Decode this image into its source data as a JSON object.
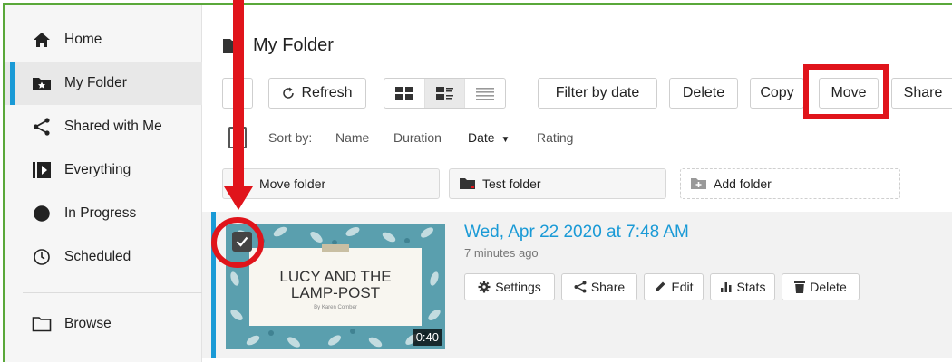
{
  "sidebar": {
    "items": [
      {
        "label": "Home",
        "icon": "home-icon"
      },
      {
        "label": "My Folder",
        "icon": "folder-star-icon",
        "active": true
      },
      {
        "label": "Shared with Me",
        "icon": "share-icon"
      },
      {
        "label": "Everything",
        "icon": "play-library-icon"
      },
      {
        "label": "In Progress",
        "icon": "half-circle-icon"
      },
      {
        "label": "Scheduled",
        "icon": "clock-icon"
      },
      {
        "label": "Browse",
        "icon": "folder-outline-icon"
      }
    ]
  },
  "header": {
    "title": "My Folder"
  },
  "toolbar": {
    "refresh": "Refresh",
    "filter": "Filter by date",
    "delete": "Delete",
    "copy": "Copy",
    "move": "Move",
    "share": "Share"
  },
  "sort": {
    "label": "Sort by:",
    "options": [
      "Name",
      "Duration",
      "Date",
      "Rating"
    ],
    "active": "Date"
  },
  "folders": [
    {
      "label": "Move folder"
    },
    {
      "label": "Test folder"
    },
    {
      "label": "Add folder"
    }
  ],
  "item": {
    "title": "Wed, Apr 22 2020 at 7:48 AM",
    "time_ago": "7 minutes ago",
    "thumbnail_title": "LUCY AND THE LAMP-POST",
    "thumbnail_author": "By Karen Comber",
    "duration": "0:40",
    "actions": [
      "Settings",
      "Share",
      "Edit",
      "Stats",
      "Delete"
    ]
  },
  "colors": {
    "accent": "#1a9ad6",
    "annotation": "#e0141b",
    "frame": "#5aa83a"
  }
}
